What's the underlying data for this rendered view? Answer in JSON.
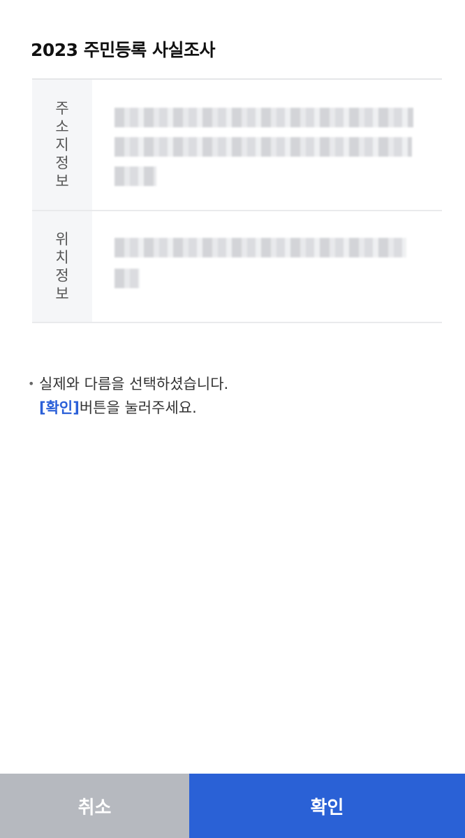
{
  "header": {
    "title": "2023 주민등록 사실조사"
  },
  "info_table": {
    "rows": [
      {
        "label": "주소지정보",
        "value": ""
      },
      {
        "label": "위치정보",
        "value": ""
      }
    ]
  },
  "notice": {
    "bullet": "•",
    "line1": "실제와 다름을 선택하셨습니다.",
    "line2_accent": "[확인]",
    "line2_rest": "버튼을 눌러주세요."
  },
  "footer": {
    "cancel_label": "취소",
    "confirm_label": "확인"
  },
  "colors": {
    "accent": "#2a61d6",
    "cancel": "#b6b9bf"
  }
}
